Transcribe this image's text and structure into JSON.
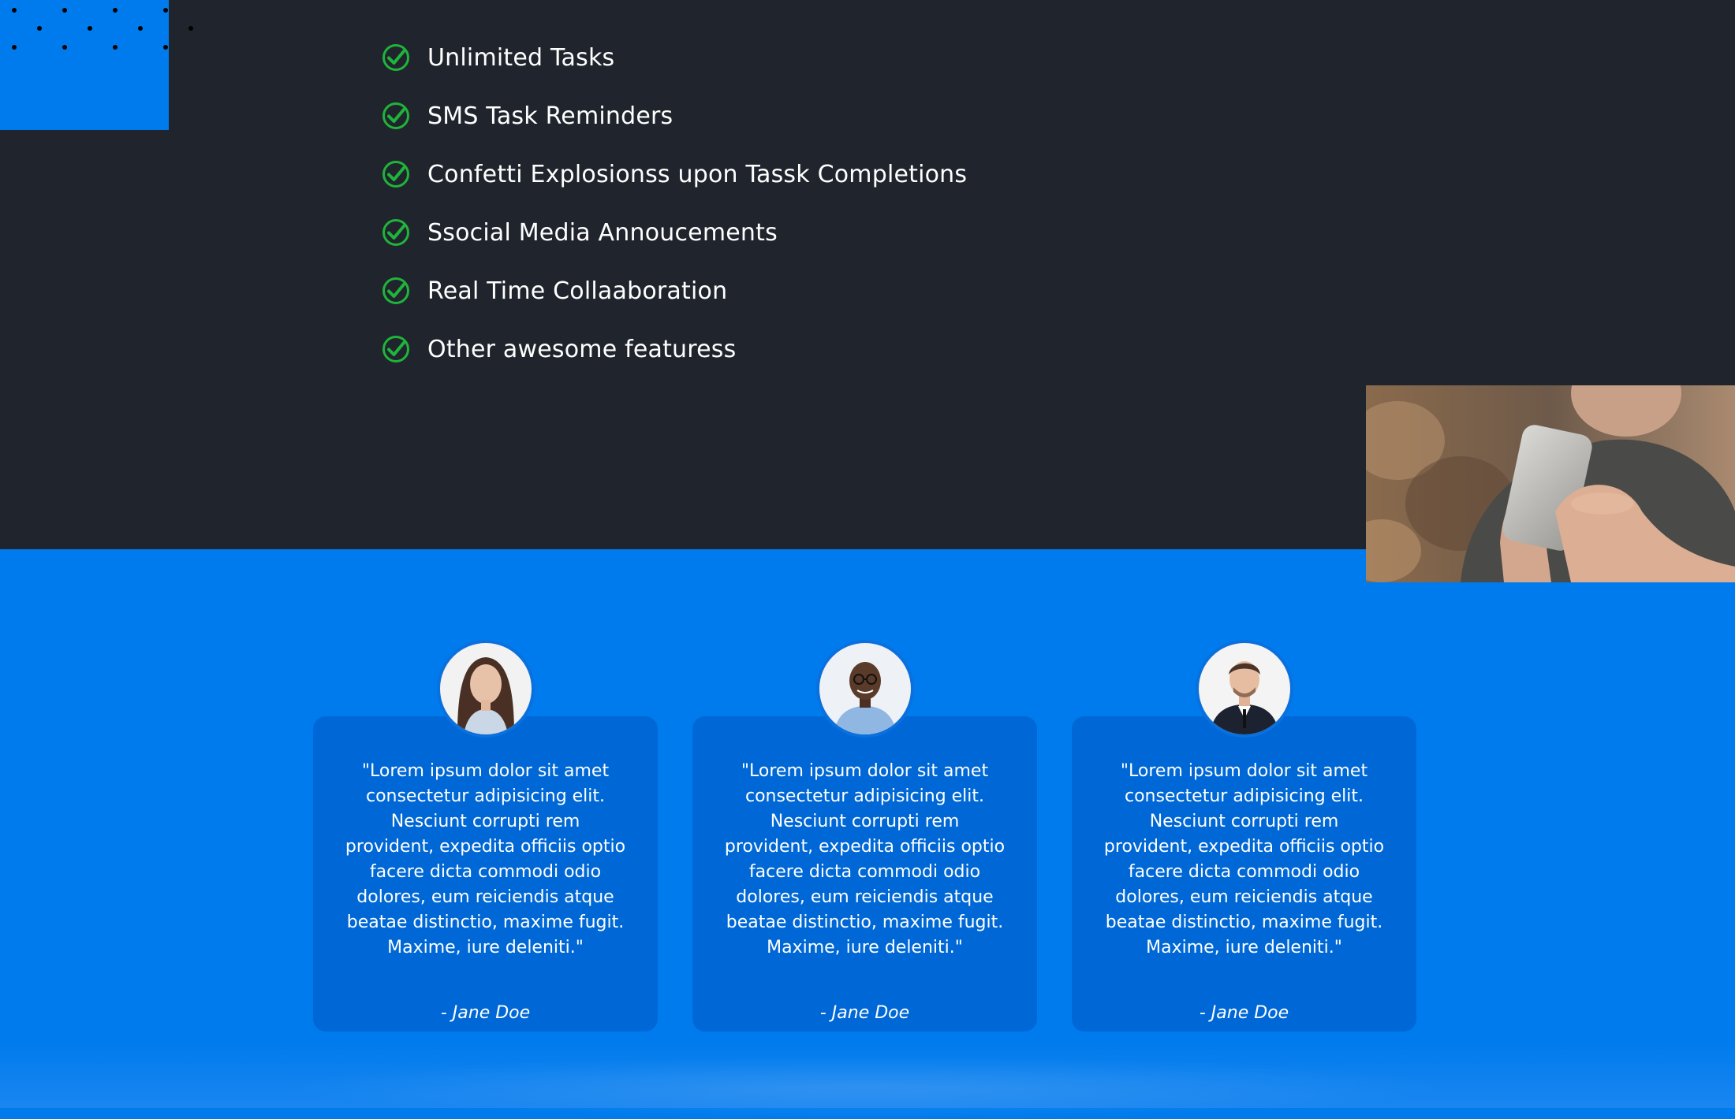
{
  "features": {
    "items": [
      {
        "label": "Unlimited Tasks"
      },
      {
        "label": "SMS Task Reminders"
      },
      {
        "label": "Confetti Explosionss upon Tassk Completions"
      },
      {
        "label": "Ssocial Media Annoucements"
      },
      {
        "label": "Real Time Collaaboration"
      },
      {
        "label": "Other awesome featuress"
      }
    ],
    "icon": "check-circle-icon",
    "check_color": "#1fb43a"
  },
  "hero_image": {
    "icon": "person-with-phone-photo"
  },
  "testimonials": [
    {
      "quote": "\"Lorem ipsum dolor sit amet consectetur adipisicing elit. Nesciunt corrupti rem provident, expedita officiis optio facere dicta commodi odio dolores, eum reiciendis atque beatae distinctio, maxime fugit. Maxime, iure deleniti.\"",
      "author": "- Jane Doe",
      "avatar": "woman-avatar"
    },
    {
      "quote": "\"Lorem ipsum dolor sit amet consectetur adipisicing elit. Nesciunt corrupti rem provident, expedita officiis optio facere dicta commodi odio dolores, eum reiciendis atque beatae distinctio, maxime fugit. Maxime, iure deleniti.\"",
      "author": "- Jane Doe",
      "avatar": "man-glasses-avatar"
    },
    {
      "quote": "\"Lorem ipsum dolor sit amet consectetur adipisicing elit. Nesciunt corrupti rem provident, expedita officiis optio facere dicta commodi odio dolores, eum reiciendis atque beatae distinctio, maxime fugit. Maxime, iure deleniti.\"",
      "author": "- Jane Doe",
      "avatar": "man-suit-avatar"
    }
  ],
  "colors": {
    "dark_bg": "#20252d",
    "brand_blue": "#007bed",
    "card_blue": "#0068d6",
    "text": "#ffffff"
  }
}
